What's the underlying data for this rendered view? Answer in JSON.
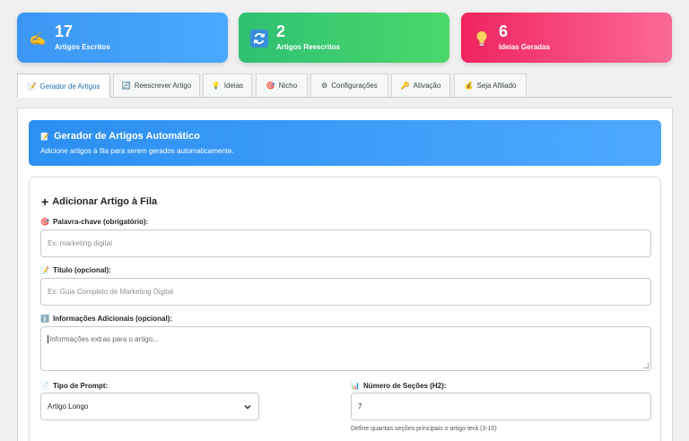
{
  "stats": [
    {
      "number": "17",
      "label": "Artigos Escritos",
      "icon": "writing-hand-icon"
    },
    {
      "number": "2",
      "label": "Artigos Reescritos",
      "icon": "refresh-icon"
    },
    {
      "number": "6",
      "label": "Ideias Geradas",
      "icon": "light-bulb-icon"
    }
  ],
  "tabs": [
    {
      "label": "Gerador de Artigos",
      "icon": "memo-icon",
      "glyph": "📝"
    },
    {
      "label": "Reescrever Artigo",
      "icon": "refresh-icon",
      "glyph": "🔄"
    },
    {
      "label": "Ideias",
      "icon": "light-bulb-icon",
      "glyph": "💡"
    },
    {
      "label": "Nicho",
      "icon": "target-icon",
      "glyph": "🎯"
    },
    {
      "label": "Configurações",
      "icon": "gear-icon",
      "glyph": "⚙"
    },
    {
      "label": "Ativação",
      "icon": "key-icon",
      "glyph": "🔑"
    },
    {
      "label": "Seja Afiliado",
      "icon": "money-bag-icon",
      "glyph": "💰"
    }
  ],
  "banner": {
    "title": "Gerador de Artigos Automático",
    "subtitle": "Adicione artigos à fila para serem gerados automaticamente."
  },
  "form": {
    "title": "Adicionar Artigo à Fila",
    "keyword_label": "Palavra-chave (obrigatório):",
    "keyword_placeholder": "Ex: marketing digital",
    "title_label": "Título (opcional):",
    "title_placeholder": "Ex: Guia Completo de Marketing Digital",
    "info_label": "Informações Adicionais (opcional):",
    "info_placeholder": "Informações extras para o artigo...",
    "prompt_label": "Tipo de Prompt:",
    "prompt_value": "Artigo Longo",
    "sections_label": "Número de Seções (H2):",
    "sections_value": "7",
    "sections_hint": "Define quantas seções principais o artigo terá (3-10)"
  },
  "colors": {
    "blue": "#3b97f4",
    "green": "#2fc072",
    "pink": "#f0245f",
    "active_tab": "#2271b1"
  }
}
